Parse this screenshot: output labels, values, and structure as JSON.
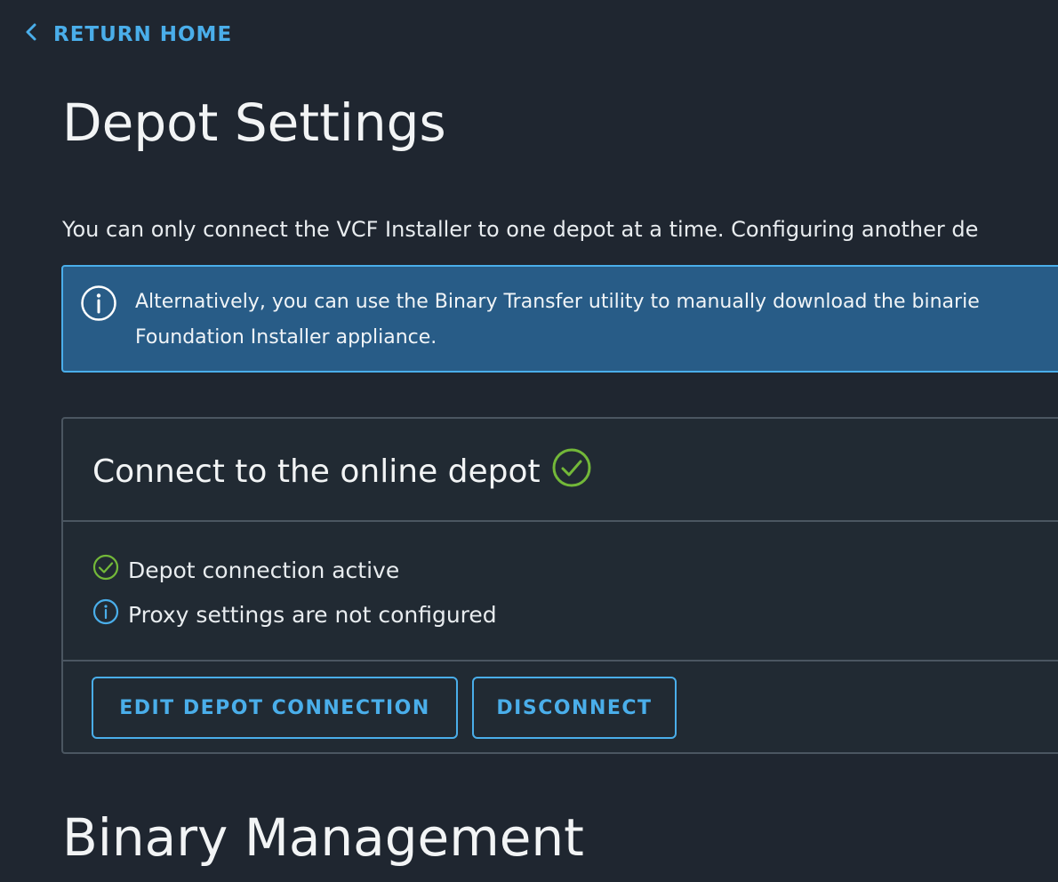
{
  "nav": {
    "return_home_label": "RETURN HOME"
  },
  "page": {
    "title": "Depot Settings",
    "intro_text": "You can only connect the VCF Installer to one depot at a time. Configuring another de"
  },
  "alert": {
    "icon": "info-circle-icon",
    "line1": "Alternatively, you can use the Binary Transfer utility to manually download the binarie",
    "line2": "Foundation Installer appliance."
  },
  "online_depot_card": {
    "title": "Connect to the online depot",
    "title_icon": "check-circle-icon",
    "statuses": [
      {
        "icon": "check-circle-icon",
        "text": "Depot connection active",
        "color": "#73b839"
      },
      {
        "icon": "info-circle-icon",
        "text": "Proxy settings are not configured",
        "color": "#4aaeea"
      }
    ],
    "edit_button_label": "EDIT DEPOT CONNECTION",
    "disconnect_button_label": "DISCONNECT"
  },
  "binary_management": {
    "title": "Binary Management"
  },
  "colors": {
    "background": "#1f2630",
    "accent": "#4aaeea",
    "success": "#73b839",
    "alert_background": "#285c87"
  }
}
